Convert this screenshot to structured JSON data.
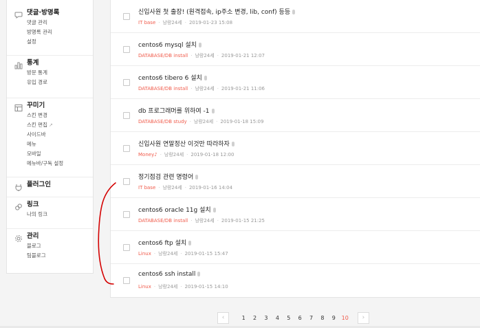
{
  "sidebar": {
    "groups": [
      {
        "title": "댓글·방명록",
        "icon": "speech-bubble-icon",
        "items": [
          "댓글 관리",
          "방명록 관리",
          "설정"
        ]
      },
      {
        "title": "통계",
        "icon": "bar-chart-icon",
        "items": [
          "방문 통계",
          "유입 경로"
        ]
      },
      {
        "title": "꾸미기",
        "icon": "layout-icon",
        "items": [
          "스킨 변경",
          "스킨 편집",
          "사이드바",
          "메뉴",
          "모바일",
          "메뉴바/구독 설정"
        ]
      },
      {
        "title": "플러그인",
        "icon": "plug-icon",
        "items": []
      },
      {
        "title": "링크",
        "icon": "link-icon",
        "items": [
          "나의 링크"
        ]
      },
      {
        "title": "관리",
        "icon": "gear-icon",
        "items": [
          "블로그",
          "팀블로그"
        ]
      }
    ],
    "external_link_icon": "external-link-icon"
  },
  "posts": [
    {
      "title": "신입사원 첫 출장! (원격접속, ip주소 변경, lib, conf) 등등",
      "category": "IT base",
      "author": "낭랑24세",
      "date": "2019-01-23 15:08"
    },
    {
      "title": "centos6 mysql 설치",
      "category": "DATABASE/DB install",
      "author": "낭랑24세",
      "date": "2019-01-21 12:07"
    },
    {
      "title": "centos6 tibero 6 설치",
      "category": "DATABASE/DB install",
      "author": "낭랑24세",
      "date": "2019-01-21 11:06"
    },
    {
      "title": "db 프로그래머를 위하여 -1",
      "category": "DATABASE/DB study",
      "author": "낭랑24세",
      "date": "2019-01-18 15:09"
    },
    {
      "title": "신입사원 연말정산 이것만 따라하자",
      "category": "Money♪",
      "author": "낭랑24세",
      "date": "2019-01-18 12:00"
    },
    {
      "title": "정기점검 관련 명령어",
      "category": "IT base",
      "author": "낭랑24세",
      "date": "2019-01-16 14:04"
    },
    {
      "title": "centos6 oracle 11g 설치",
      "category": "DATABASE/DB install",
      "author": "낭랑24세",
      "date": "2019-01-15 21:25"
    },
    {
      "title": "centos6 ftp 설치",
      "category": "Linux",
      "author": "낭랑24세",
      "date": "2019-01-15 15:47"
    },
    {
      "title": "centos6 ssh install",
      "category": "Linux",
      "author": "낭랑24세",
      "date": "2019-01-15 14:10"
    }
  ],
  "pagination": {
    "prev": "‹",
    "next": "›",
    "pages": [
      "1",
      "2",
      "3",
      "4",
      "5",
      "6",
      "7",
      "8",
      "9",
      "10"
    ],
    "current": "10"
  },
  "colors": {
    "accent": "#f05a4a",
    "annotation": "#d40000"
  }
}
